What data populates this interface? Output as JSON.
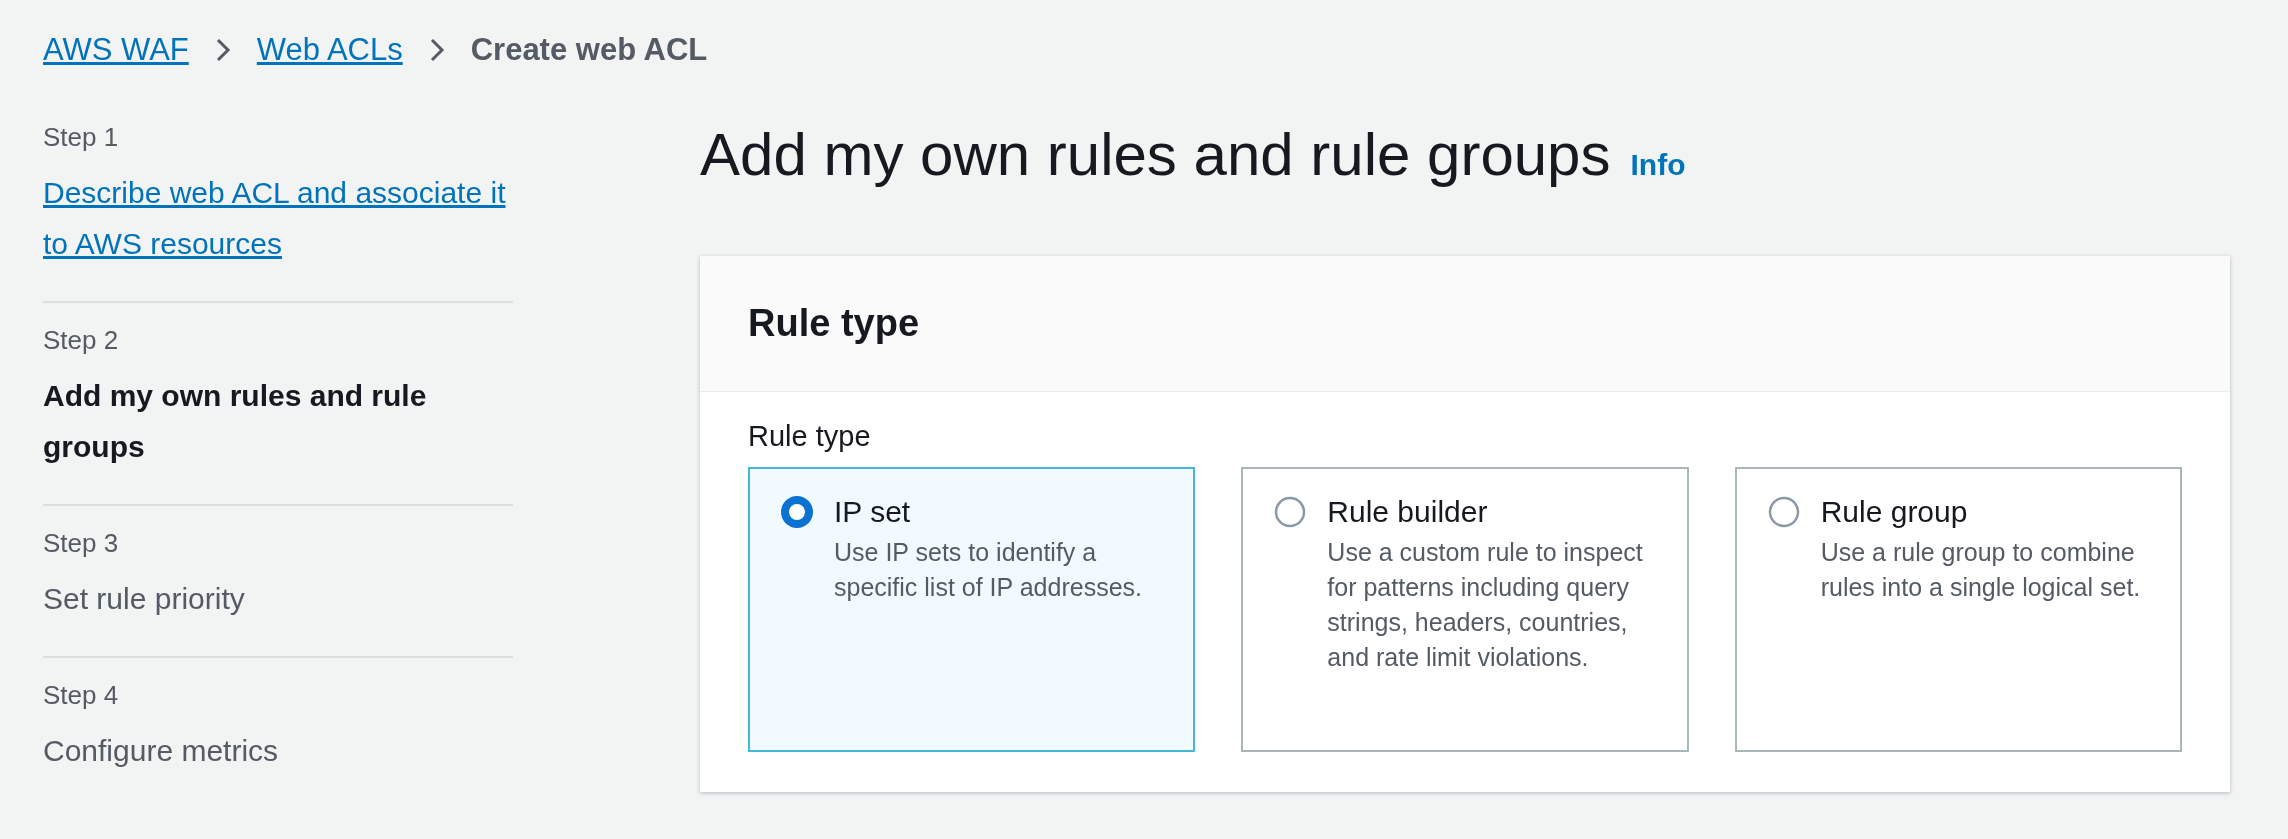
{
  "breadcrumb": [
    {
      "label": "AWS WAF",
      "kind": "link"
    },
    {
      "label": "Web ACLs",
      "kind": "link"
    },
    {
      "label": "Create web ACL",
      "kind": "current"
    }
  ],
  "steps": [
    {
      "step": "Step 1",
      "title": "Describe web ACL and associate it to AWS resources",
      "kind": "link"
    },
    {
      "step": "Step 2",
      "title": "Add my own rules and rule groups",
      "kind": "current"
    },
    {
      "step": "Step 3",
      "title": "Set rule priority",
      "kind": "pending"
    },
    {
      "step": "Step 4",
      "title": "Configure metrics",
      "kind": "pending"
    }
  ],
  "page": {
    "title": "Add my own rules and rule groups",
    "info": "Info"
  },
  "panel": {
    "title": "Rule type",
    "field_label": "Rule type",
    "options": [
      {
        "label": "IP set",
        "description": "Use IP sets to identify a specific list of IP addresses.",
        "selected": true
      },
      {
        "label": "Rule builder",
        "description": "Use a custom rule to inspect for patterns including query strings, headers, countries, and rate limit violations.",
        "selected": false
      },
      {
        "label": "Rule group",
        "description": "Use a rule group to combine rules into a single logical set.",
        "selected": false
      }
    ]
  }
}
